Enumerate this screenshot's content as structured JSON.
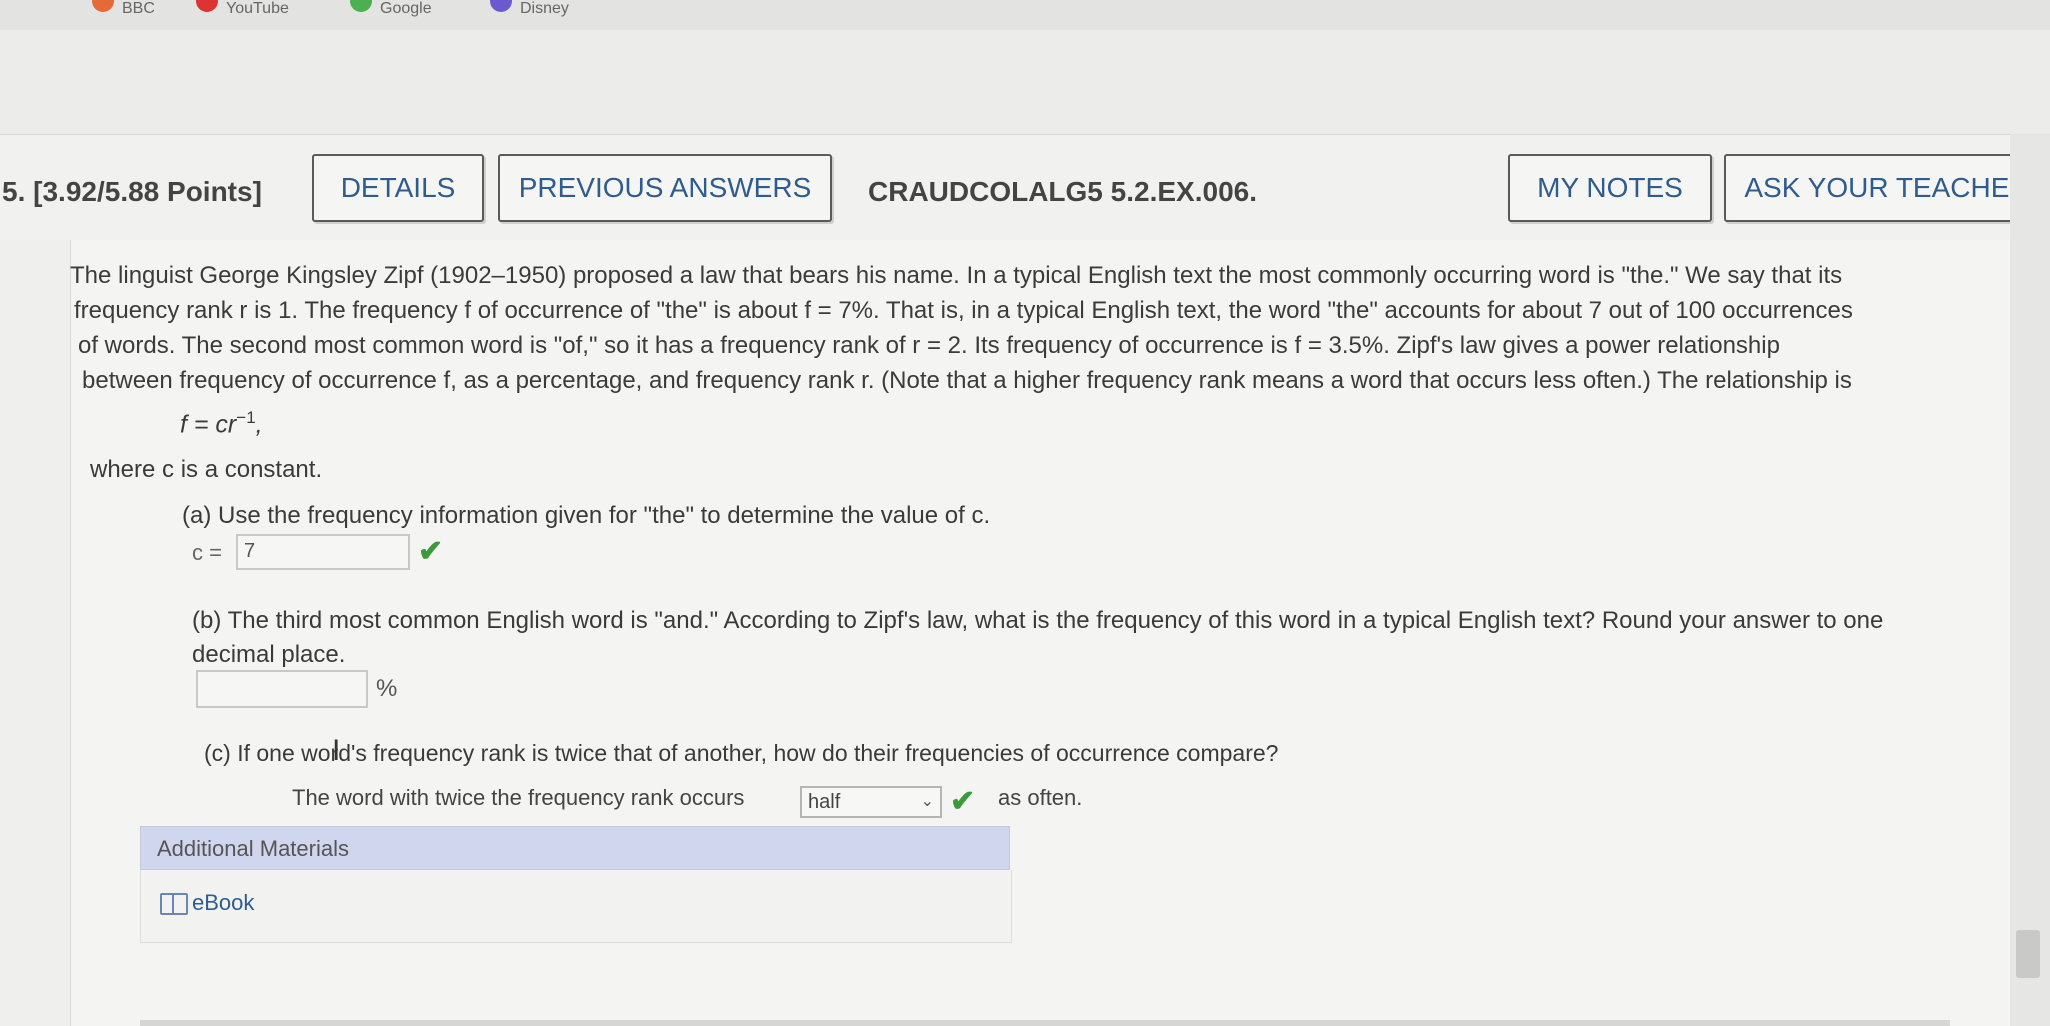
{
  "bookmarks": [
    "BBC",
    "YouTube",
    "Google",
    "Disney"
  ],
  "question": {
    "number_label": "5.",
    "points": "[3.92/5.88 Points]",
    "buttons": {
      "details": "DETAILS",
      "previous_answers": "PREVIOUS ANSWERS",
      "my_notes": "MY NOTES",
      "ask_teacher": "ASK YOUR TEACHER"
    },
    "code": "CRAUDCOLALG5 5.2.EX.006."
  },
  "body": {
    "paragraph_lines": [
      "The linguist George Kingsley Zipf (1902–1950) proposed a law that bears his name. In a typical English text the most commonly occurring word is \"the.\" We say that its",
      "frequency rank r is 1. The frequency f of occurrence of \"the\" is about  f = 7%.  That is, in a typical English text, the word \"the\" accounts for about 7 out of 100 occurrences",
      "of words. The second most common word is \"of,\" so it has a frequency rank of  r = 2.  Its frequency of occurrence is  f = 3.5%.  Zipf's law gives a power relationship",
      "between frequency of occurrence f, as a percentage, and frequency rank r. (Note that a higher frequency rank means a word that occurs less often.) The relationship is"
    ],
    "equation": "f = cr",
    "equation_exp": "−1",
    "equation_end": ",",
    "where": "where c is a constant.",
    "part_a": {
      "prompt": "(a) Use the frequency information given for \"the\" to determine the value of c.",
      "label": "c =",
      "value": "7"
    },
    "part_b": {
      "prompt": "(b) The third most common English word is \"and.\" According to Zipf's law, what is the frequency of this word in a typical English text? Round your answer to one decimal place.",
      "value": "",
      "unit": "%"
    },
    "part_c": {
      "prompt": "(c) If one word's frequency rank is twice that of another, how do their frequencies of occurrence compare?",
      "sentence_start": "The word with twice the frequency rank occurs",
      "selected": "half",
      "sentence_end": "as often."
    }
  },
  "additional": {
    "header": "Additional Materials",
    "ebook": "eBook"
  }
}
